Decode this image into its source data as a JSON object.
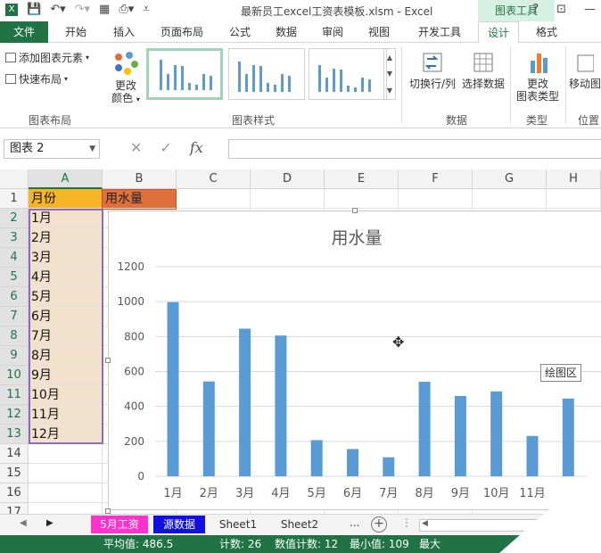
{
  "window": {
    "title": "最新员工excel工资表模板.xlsm - Excel",
    "context_tab_title": "图表工具",
    "help": "?",
    "minimize": "—",
    "restore": "▢"
  },
  "tabs": [
    "文件",
    "开始",
    "插入",
    "页面布局",
    "公式",
    "数据",
    "审阅",
    "视图",
    "开发工具",
    "设计",
    "格式"
  ],
  "ribbon": {
    "add_element": "添加图表元素",
    "quick_layout": "快速布局",
    "change_colors_1": "更改",
    "change_colors_2": "颜色",
    "switch_rowcol": "切换行/列",
    "select_data": "选择数据",
    "change_type_1": "更改",
    "change_type_2": "图表类型",
    "move_chart": "移动图",
    "group_layout": "图表布局",
    "group_styles": "图表样式",
    "group_data": "数据",
    "group_type": "类型",
    "group_location": "位置"
  },
  "formula_bar": {
    "name_box": "图表 2",
    "cancel": "✕",
    "enter": "✓",
    "fx": "fx",
    "value": ""
  },
  "columns": [
    "A",
    "B",
    "C",
    "D",
    "E",
    "F",
    "G",
    "H"
  ],
  "rows": [
    "1",
    "2",
    "3",
    "4",
    "5",
    "6",
    "7",
    "8",
    "9",
    "10",
    "11",
    "12",
    "13",
    "14",
    "15",
    "16",
    "17"
  ],
  "cells": {
    "A1": "月份",
    "B1": "用水量",
    "months": [
      "1月",
      "2月",
      "3月",
      "4月",
      "5月",
      "6月",
      "7月",
      "8月",
      "9月",
      "10月",
      "11月",
      "12月"
    ]
  },
  "chart_data": {
    "type": "bar",
    "title": "用水量",
    "categories": [
      "1月",
      "2月",
      "3月",
      "4月",
      "5月",
      "6月",
      "7月",
      "8月",
      "9月",
      "10月",
      "11月"
    ],
    "values": [
      997,
      543,
      845,
      806,
      207,
      156,
      109,
      541,
      460,
      486,
      231,
      445
    ],
    "ylim": [
      0,
      1200
    ],
    "yticks": [
      0,
      200,
      400,
      600,
      800,
      1000,
      1200
    ],
    "grid": true,
    "bar_color": "#5b9bd5",
    "xlabel": "",
    "ylabel": ""
  },
  "tooltip": "绘图区",
  "sheet_tabs": [
    {
      "label": "5月工资",
      "bg": "#ff33cc",
      "fg": "#ffffff"
    },
    {
      "label": "源数据",
      "bg": "#1010e0",
      "fg": "#ffffff"
    },
    {
      "label": "Sheet1",
      "bg": "#f3f3f3",
      "fg": "#333333"
    },
    {
      "label": "Sheet2",
      "bg": "#f3f3f3",
      "fg": "#333333"
    }
  ],
  "sheet_more": "...",
  "sheet_add": "+",
  "status": {
    "average": "平均值: 486.5",
    "count": "计数: 26",
    "numeric_count": "数值计数: 12",
    "min": "最小值: 109",
    "max": "最大"
  },
  "colors": {
    "excel_green": "#217346",
    "a1_fill": "#f6b526",
    "b1_fill": "#e0703b",
    "month_fill": "#f2e2cd"
  }
}
